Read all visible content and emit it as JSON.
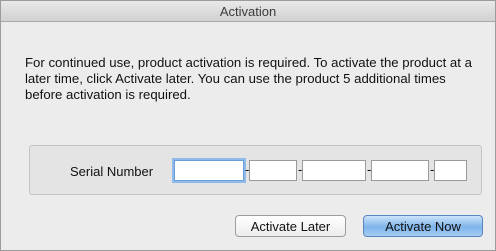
{
  "window": {
    "title": "Activation"
  },
  "message": "For continued use, product activation is required.  To activate the product at a later time, click Activate later.  You can use the product 5 additional times before activation is required.",
  "serial": {
    "label": "Serial Number",
    "separator": "-",
    "fields": [
      "",
      "",
      "",
      "",
      ""
    ]
  },
  "buttons": {
    "later_label": "Activate Later",
    "now_label": "Activate Now"
  },
  "colors": {
    "focus_ring": "#8fbaeb",
    "default_button": "#7eb4ea"
  }
}
